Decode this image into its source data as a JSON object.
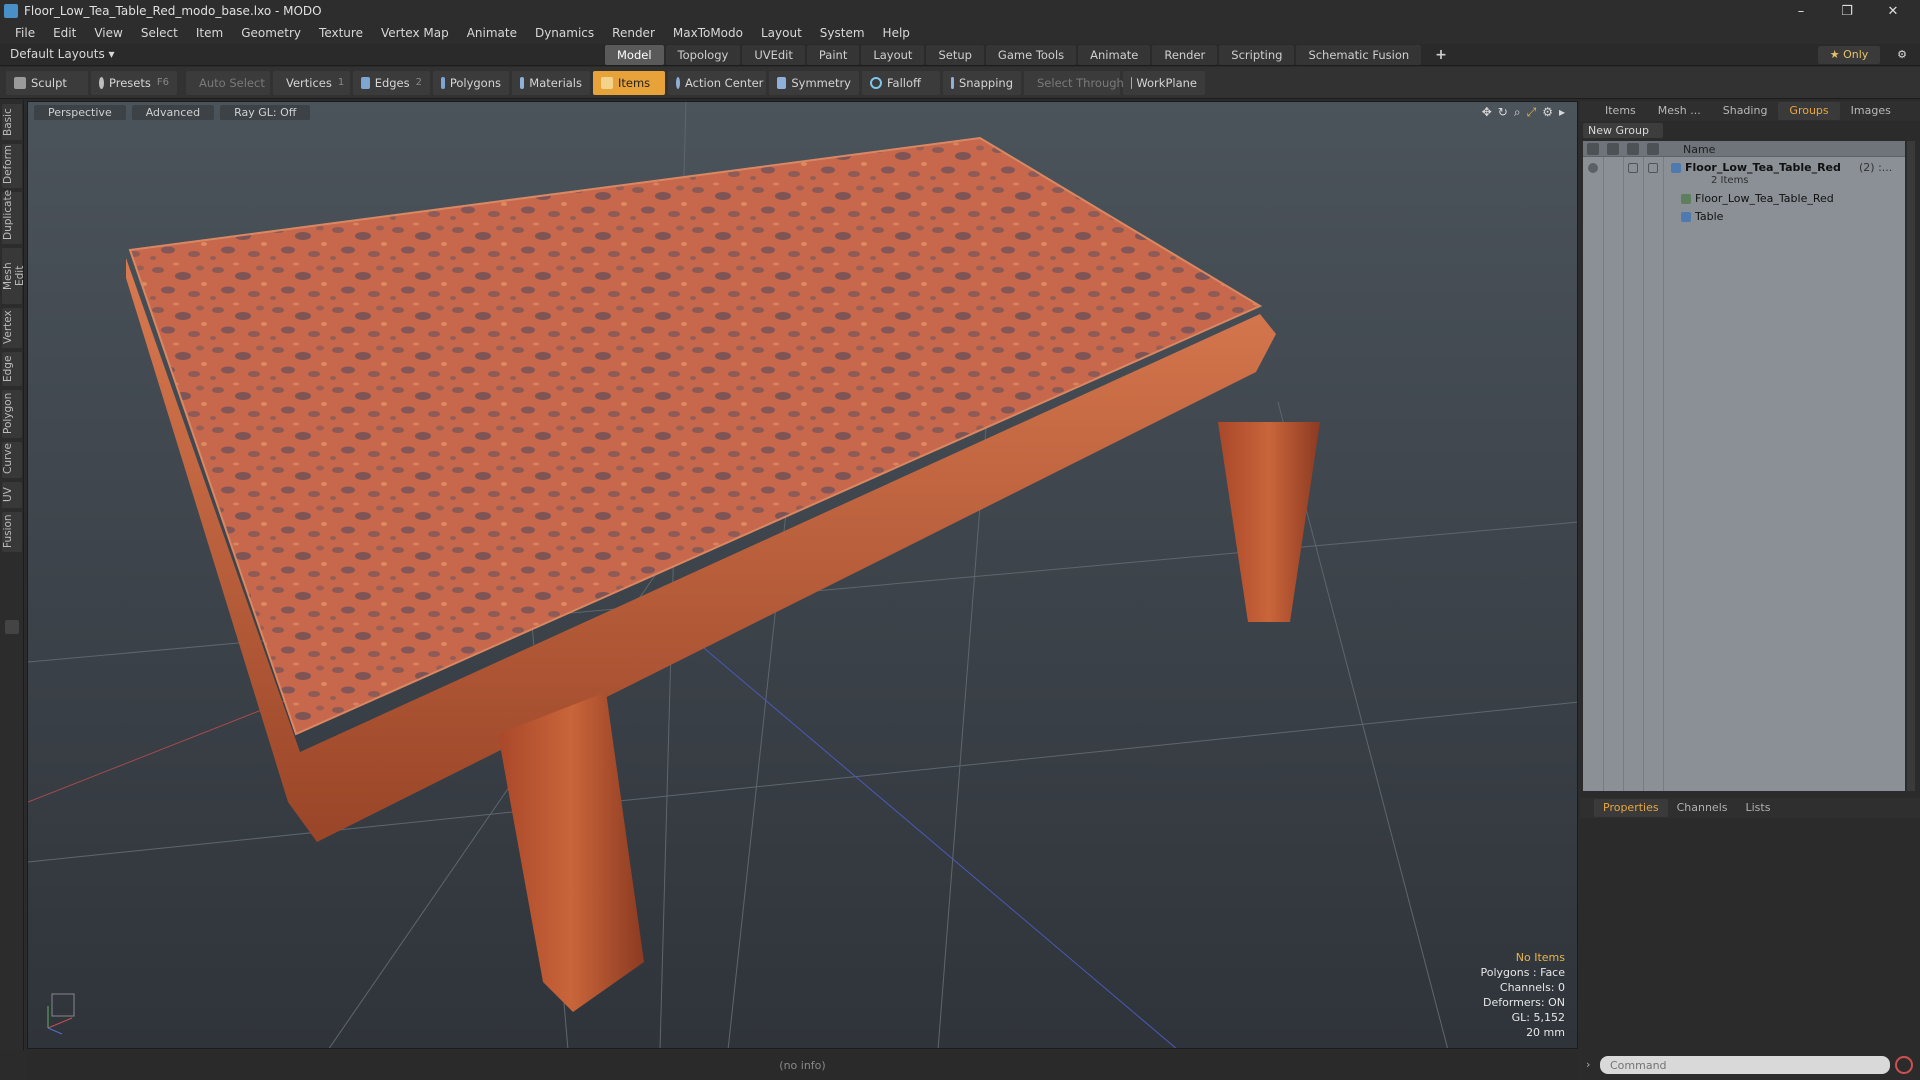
{
  "window": {
    "title": "Floor_Low_Tea_Table_Red_modo_base.lxo - MODO",
    "controls": [
      "–",
      "❐",
      "✕"
    ]
  },
  "menu": [
    "File",
    "Edit",
    "View",
    "Select",
    "Item",
    "Geometry",
    "Texture",
    "Vertex Map",
    "Animate",
    "Dynamics",
    "Render",
    "MaxToModo",
    "Layout",
    "System",
    "Help"
  ],
  "layout": {
    "selector": "Default Layouts ▾",
    "tabs": [
      "Model",
      "Topology",
      "UVEdit",
      "Paint",
      "Layout",
      "Setup",
      "Game Tools",
      "Animate",
      "Render",
      "Scripting",
      "Schematic Fusion"
    ],
    "active_tab": "Model",
    "add": "+",
    "only": "★ Only",
    "gear": "⚙"
  },
  "toolbar": {
    "sculpt": "Sculpt",
    "presets": "Presets",
    "presets_key": "F6",
    "auto_select": "Auto Select",
    "vertices": "Vertices",
    "vertices_key": "1",
    "edges": "Edges",
    "edges_key": "2",
    "polygons": "Polygons",
    "materials": "Materials",
    "items": "Items",
    "action_center": "Action Center",
    "symmetry": "Symmetry",
    "falloff": "Falloff",
    "snapping": "Snapping",
    "select_through": "Select Through",
    "workplane": "WorkPlane"
  },
  "left_tabs": [
    "Basic",
    "Deform",
    "Duplicate",
    "Mesh Edit",
    "Vertex",
    "Edge",
    "Polygon",
    "Curve",
    "UV",
    "Fusion"
  ],
  "viewport": {
    "view": "Perspective",
    "shading": "Advanced",
    "raygl": "Ray GL: Off",
    "info": {
      "items": "No Items",
      "polygons": "Polygons : Face",
      "channels": "Channels: 0",
      "deformers": "Deformers: ON",
      "gl": "GL: 5,152",
      "scale": "20 mm"
    },
    "axis_labels": {
      "x": "",
      "y": "",
      "z": ""
    }
  },
  "status": "(no info)",
  "right_panel": {
    "tabs": [
      "Items",
      "Mesh ...",
      "Shading",
      "Groups",
      "Images"
    ],
    "active_tab": "Groups",
    "new_group": "New Group",
    "column_name": "Name",
    "group": {
      "name": "Floor_Low_Tea_Table_Red",
      "count": "(2) :...",
      "sub": "2 Items"
    },
    "children": [
      "Floor_Low_Tea_Table_Red",
      "Table"
    ],
    "bottom_tabs": [
      "Properties",
      "Channels",
      "Lists"
    ],
    "bottom_active": "Properties",
    "command_placeholder": "Command"
  },
  "colors": {
    "accent": "#e9a53e",
    "active_button": "#e8a23a",
    "table_top": "#c8664a",
    "table_wood": "#b8542c"
  }
}
